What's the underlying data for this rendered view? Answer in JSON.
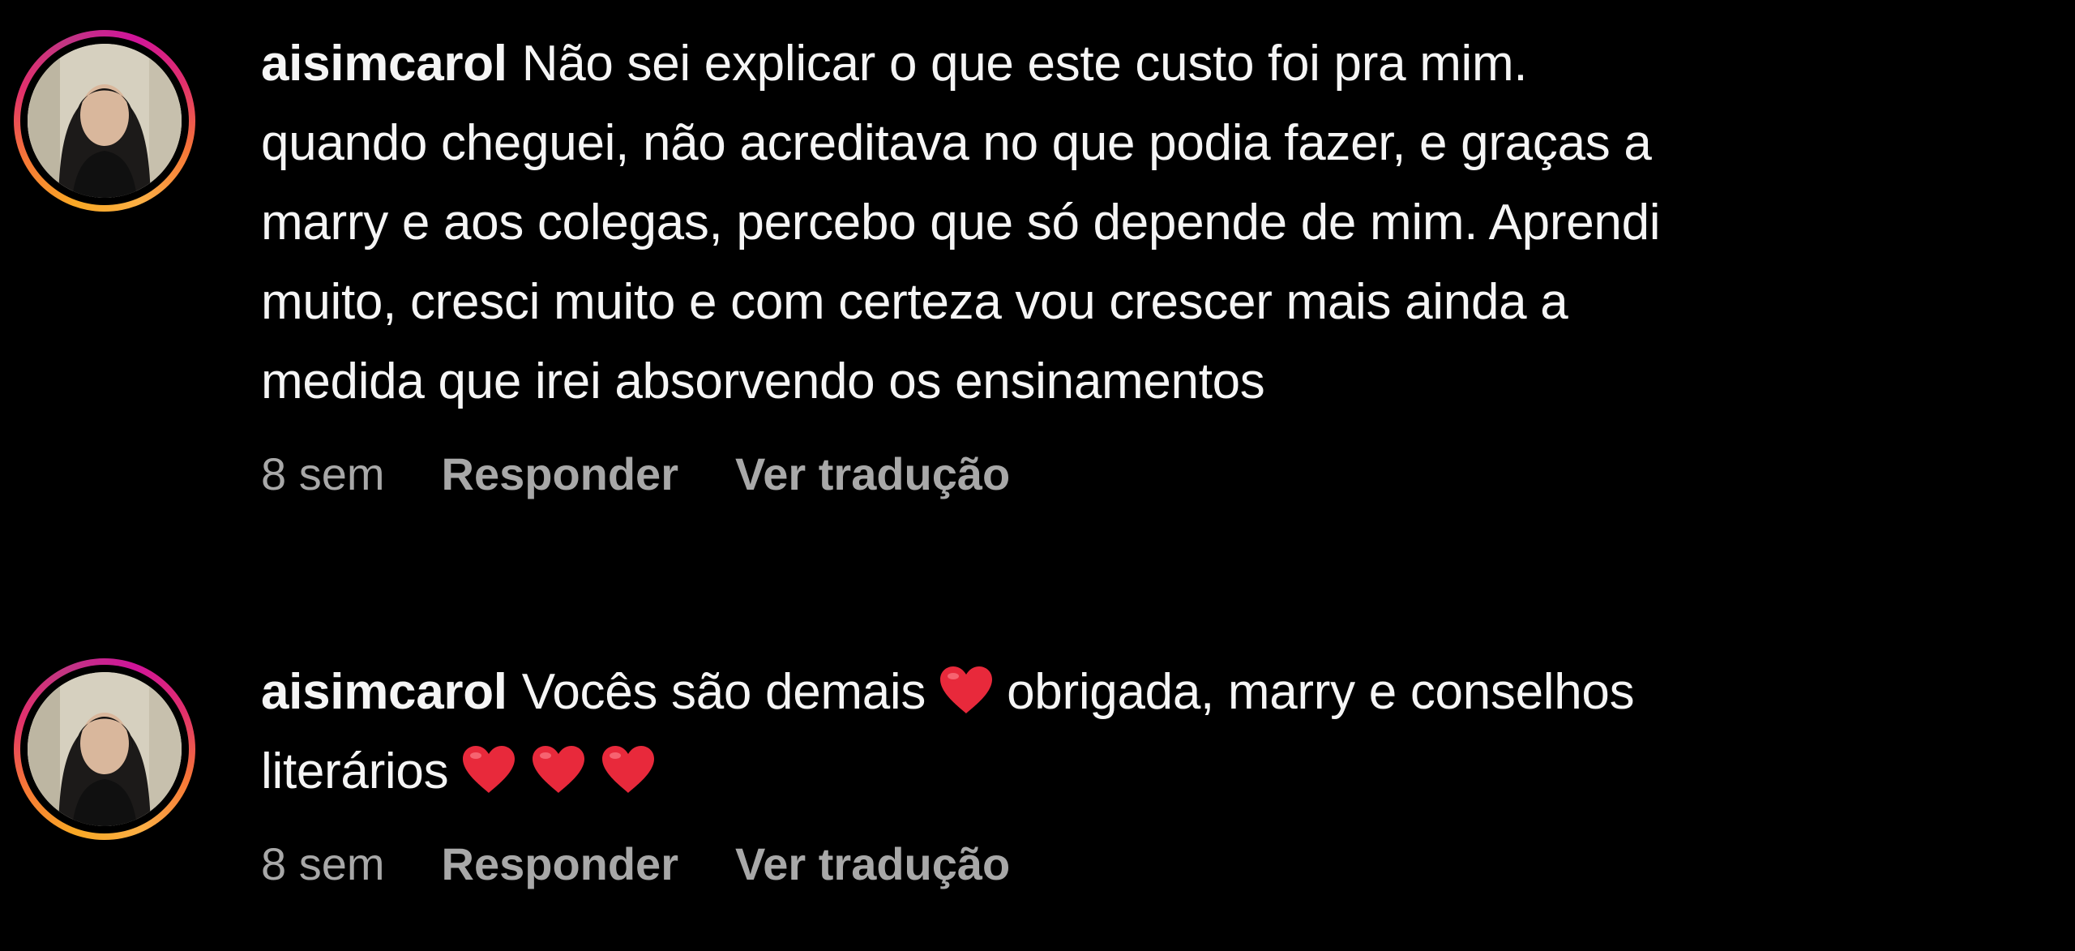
{
  "comments": [
    {
      "username": "aisimcarol",
      "lines": [
        "Não sei explicar o que este custo foi pra mim.",
        "quando cheguei, não acreditava no que podia fazer, e graças a",
        "marry e aos colegas, percebo que só depende de mim. Aprendi",
        "muito, cresci muito e com certeza vou crescer mais ainda a",
        "medida que irei absorvendo os ensinamentos"
      ],
      "time": "8 sem",
      "reply_label": "Responder",
      "translate_label": "Ver tradução"
    },
    {
      "username": "aisimcarol",
      "line1_text": "Vocês são demais",
      "line1_after": "obrigada, marry e conselhos",
      "line2_text": "literários",
      "time": "8 sem",
      "reply_label": "Responder",
      "translate_label": "Ver tradução"
    }
  ],
  "icons": {
    "heart": "red-heart-emoji"
  },
  "colors": {
    "background": "#000000",
    "text": "#f5f5f5",
    "meta": "#a8a8a8",
    "heart": "#e8293b"
  }
}
